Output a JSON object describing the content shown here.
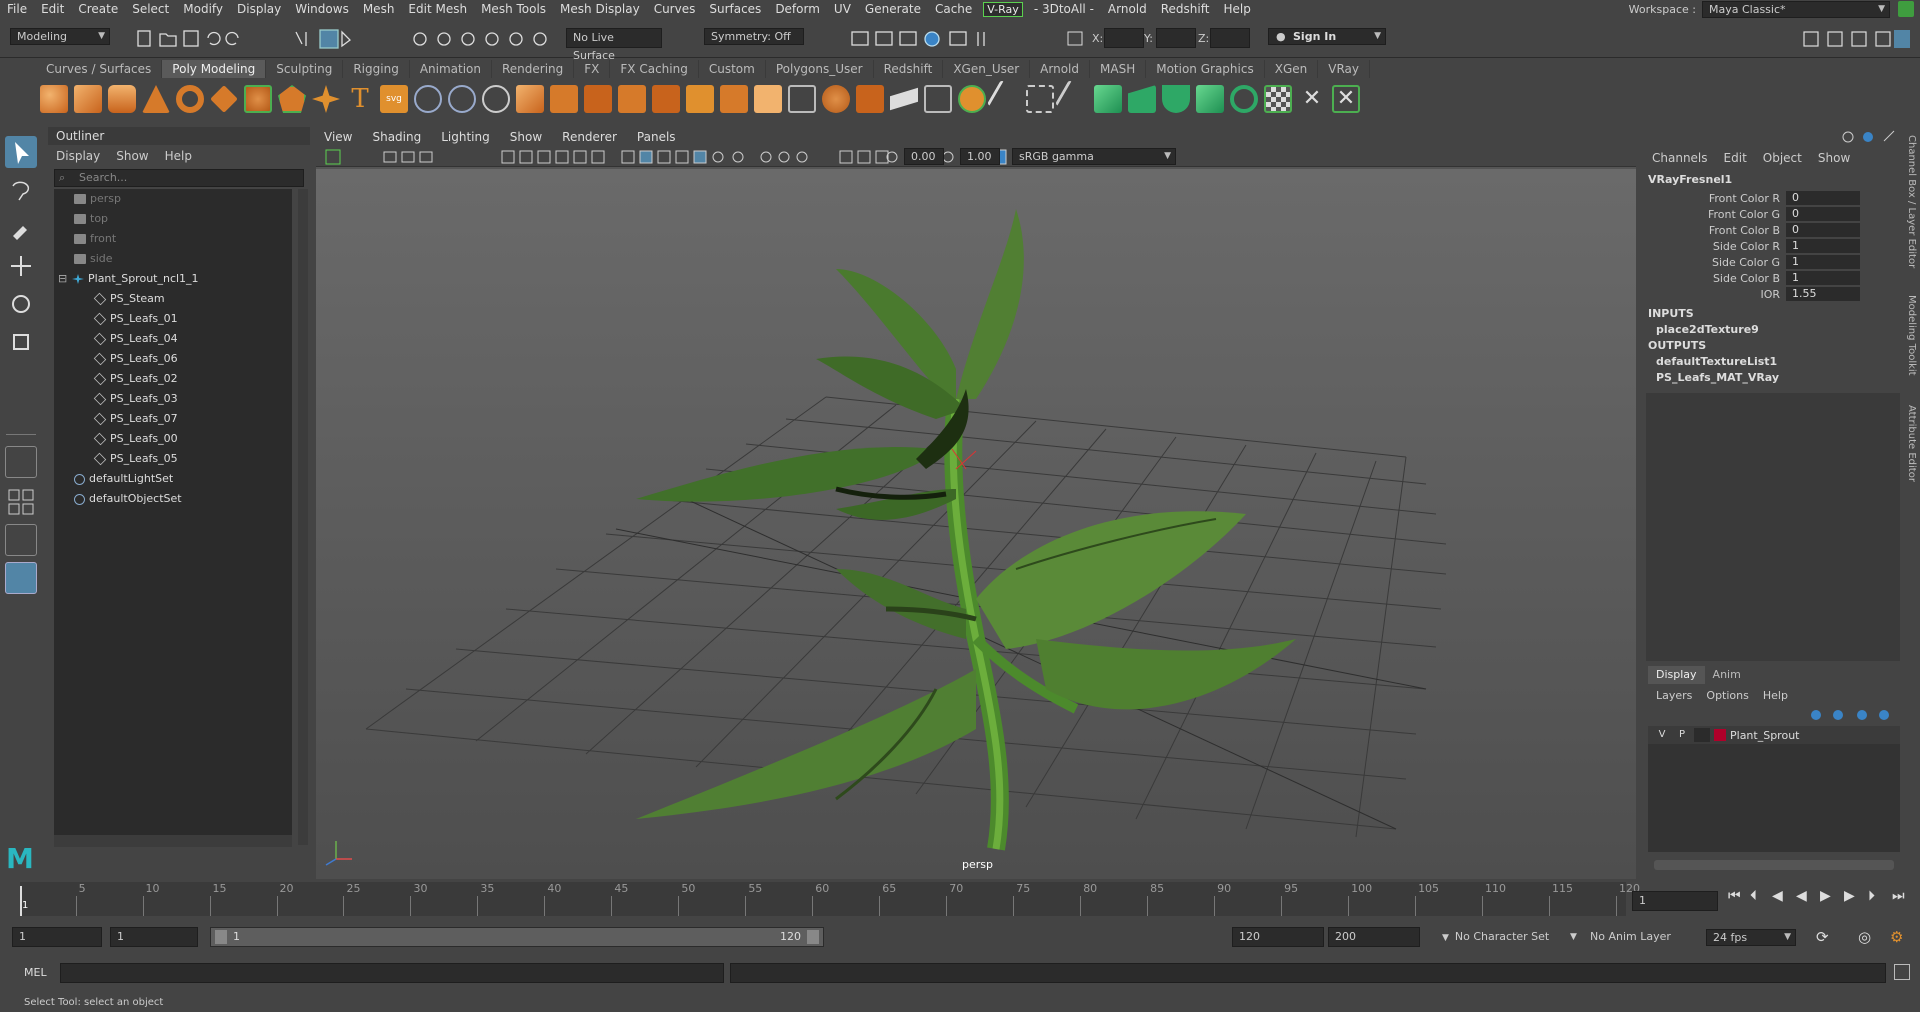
{
  "menu": [
    "File",
    "Edit",
    "Create",
    "Select",
    "Modify",
    "Display",
    "Windows",
    "Mesh",
    "Edit Mesh",
    "Mesh Tools",
    "Mesh Display",
    "Curves",
    "Surfaces",
    "Deform",
    "UV",
    "Generate",
    "Cache"
  ],
  "menu_vray": "V-Ray",
  "menu_after": [
    "- 3DtoAll -",
    "Arnold",
    "Redshift",
    "Help"
  ],
  "workspace": {
    "label": "Workspace :",
    "value": "Maya Classic*"
  },
  "status": {
    "mode": "Modeling",
    "live_surface": "No Live Surface",
    "symmetry": "Symmetry: Off",
    "x_label": "X:",
    "y_label": "Y:",
    "z_label": "Z:",
    "sign_in": "Sign In"
  },
  "shelf_tabs": [
    "Curves / Surfaces",
    "Poly Modeling",
    "Sculpting",
    "Rigging",
    "Animation",
    "Rendering",
    "FX",
    "FX Caching",
    "Custom",
    "Polygons_User",
    "Redshift",
    "XGen_User",
    "Arnold",
    "MASH",
    "Motion Graphics",
    "XGen",
    "VRay"
  ],
  "shelf_active": "Poly Modeling",
  "outliner": {
    "title": "Outliner",
    "menu": [
      "Display",
      "Show",
      "Help"
    ],
    "search_placeholder": "Search...",
    "items": [
      {
        "label": "persp",
        "kind": "camera",
        "dim": true
      },
      {
        "label": "top",
        "kind": "camera",
        "dim": true
      },
      {
        "label": "front",
        "kind": "camera",
        "dim": true
      },
      {
        "label": "side",
        "kind": "camera",
        "dim": true
      },
      {
        "label": "Plant_Sprout_ncl1_1",
        "kind": "group",
        "dim": false
      },
      {
        "label": "PS_Steam",
        "kind": "mesh",
        "dim": false
      },
      {
        "label": "PS_Leafs_01",
        "kind": "mesh",
        "dim": false
      },
      {
        "label": "PS_Leafs_04",
        "kind": "mesh",
        "dim": false
      },
      {
        "label": "PS_Leafs_06",
        "kind": "mesh",
        "dim": false
      },
      {
        "label": "PS_Leafs_02",
        "kind": "mesh",
        "dim": false
      },
      {
        "label": "PS_Leafs_03",
        "kind": "mesh",
        "dim": false
      },
      {
        "label": "PS_Leafs_07",
        "kind": "mesh",
        "dim": false
      },
      {
        "label": "PS_Leafs_00",
        "kind": "mesh",
        "dim": false
      },
      {
        "label": "PS_Leafs_05",
        "kind": "mesh",
        "dim": false
      },
      {
        "label": "defaultLightSet",
        "kind": "set",
        "dim": false
      },
      {
        "label": "defaultObjectSet",
        "kind": "set",
        "dim": false
      }
    ]
  },
  "viewport": {
    "menu": [
      "View",
      "Shading",
      "Lighting",
      "Show",
      "Renderer",
      "Panels"
    ],
    "exposure": "0.00",
    "gamma": "1.00",
    "colorspace": "sRGB gamma",
    "camera": "persp"
  },
  "channelbox": {
    "menu": [
      "Channels",
      "Edit",
      "Object",
      "Show"
    ],
    "node": "VRayFresnel1",
    "attrs": [
      {
        "label": "Front Color R",
        "value": "0"
      },
      {
        "label": "Front Color G",
        "value": "0"
      },
      {
        "label": "Front Color B",
        "value": "0"
      },
      {
        "label": "Side Color R",
        "value": "1"
      },
      {
        "label": "Side Color G",
        "value": "1"
      },
      {
        "label": "Side Color B",
        "value": "1"
      },
      {
        "label": "IOR",
        "value": "1.55"
      }
    ],
    "inputs_label": "INPUTS",
    "inputs": [
      "place2dTexture9"
    ],
    "outputs_label": "OUTPUTS",
    "outputs": [
      "defaultTextureList1",
      "PS_Leafs_MAT_VRay"
    ]
  },
  "layers": {
    "tabs": [
      "Display",
      "Anim"
    ],
    "menu": [
      "Layers",
      "Options",
      "Help"
    ],
    "row": {
      "v": "V",
      "p": "P",
      "name": "Plant_Sprout",
      "color": "#b0002a"
    }
  },
  "side_tabs": [
    "Channel Box / Layer Editor",
    "Modeling Toolkit",
    "Attribute Editor"
  ],
  "timeline": {
    "ticks": [
      "5",
      "10",
      "15",
      "20",
      "25",
      "30",
      "35",
      "40",
      "45",
      "50",
      "55",
      "60",
      "65",
      "70",
      "75",
      "80",
      "85",
      "90",
      "95",
      "100",
      "105",
      "110",
      "115",
      "120"
    ],
    "current_frame": "1",
    "start_marker": "1"
  },
  "range": {
    "start": "1",
    "playback_start": "1",
    "slider_start": "1",
    "slider_end": "120",
    "playback_end": "120",
    "end": "200",
    "character_set": "No Character Set",
    "anim_layer": "No Anim Layer",
    "fps": "24 fps"
  },
  "command": {
    "lang": "MEL"
  },
  "help_text": "Select Tool: select an object"
}
